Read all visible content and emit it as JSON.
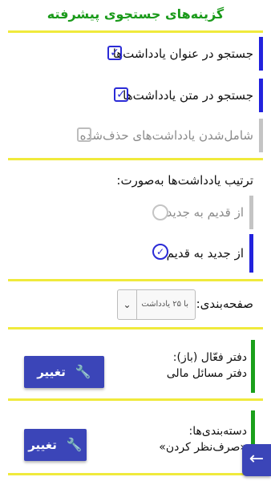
{
  "header": {
    "title": "گزینه‌های جستجوی پیشرفته"
  },
  "search_options": {
    "title_search": {
      "label": "جستجو در عنوان یادداشت‌ها",
      "checked": true
    },
    "body_search": {
      "label": "جستجو در متن یادداشت‌ها",
      "checked": true
    },
    "include_deleted": {
      "label": "شامل‌شدن یادداشت‌های حذف‌شده",
      "checked": false
    }
  },
  "sort": {
    "label": "ترتیب یادداشت‌ها به‌صورت:",
    "options": [
      {
        "label": "از قدیم به جدید",
        "selected": false
      },
      {
        "label": "از جدید به قدیم",
        "selected": true
      }
    ]
  },
  "paging": {
    "label": "صفحه‌بندی:",
    "value": "با ۲۵ یادداشت"
  },
  "notebook": {
    "line1": "دفتر فعّال (باز):",
    "line2": "دفتر مسائل مالی",
    "button_label": "تغییر"
  },
  "categories": {
    "line1": "دسته‌بندی‌ها:",
    "line2": "«صرف‌نظر کردن»",
    "button_label": "تغییر"
  },
  "icons": {
    "checkbox": "check-icon",
    "radio": "radio-check-icon",
    "wrench": "wrench-icon",
    "back": "back-arrow-icon"
  },
  "colors": {
    "accent": "#2b2bd6",
    "green": "#1aa01a",
    "separator": "#f0ea3c",
    "button": "#3b45b8"
  }
}
